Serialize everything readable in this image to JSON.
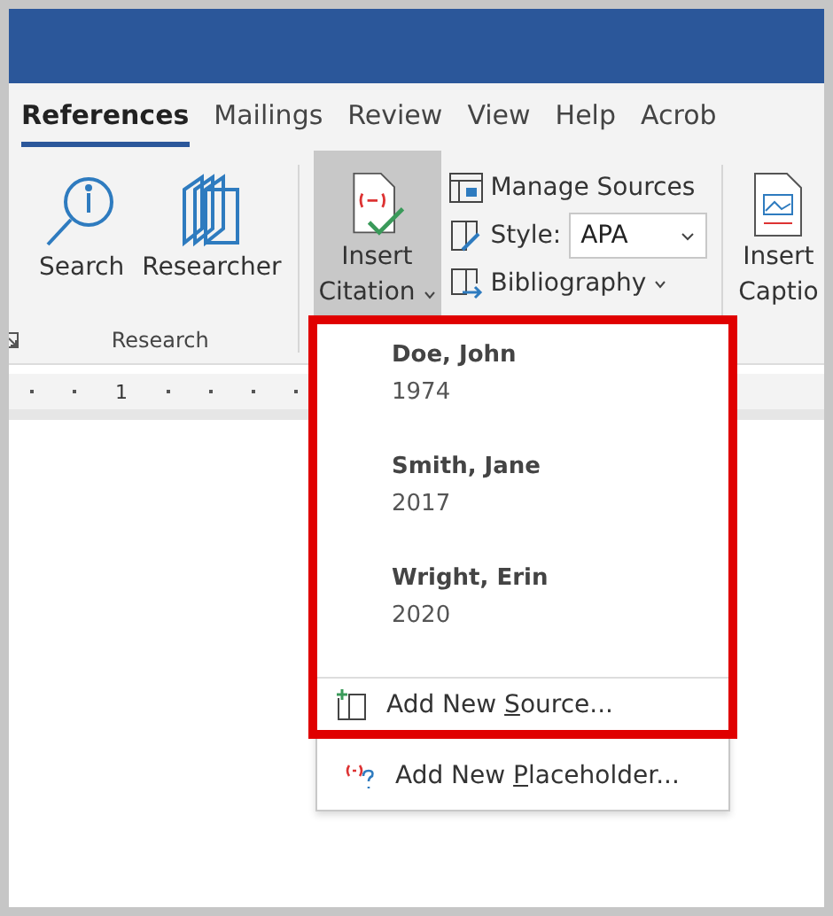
{
  "tabs": [
    {
      "label": "References",
      "selected": true
    },
    {
      "label": "Mailings",
      "selected": false
    },
    {
      "label": "Review",
      "selected": false
    },
    {
      "label": "View",
      "selected": false
    },
    {
      "label": "Help",
      "selected": false
    },
    {
      "label": "Acrob",
      "selected": false
    }
  ],
  "ribbon": {
    "research": {
      "buttons": [
        {
          "label": "Search",
          "kind": "search"
        },
        {
          "label": "Researcher",
          "kind": "researcher"
        }
      ],
      "group_label": "Research"
    },
    "insert_citation": {
      "label_lines": [
        "Insert",
        "Citation"
      ],
      "pressed": true
    },
    "manage_sources": "Manage Sources",
    "style_label": "Style:",
    "style_value": "APA",
    "bibliography": "Bibliography",
    "insert_caption": {
      "label_lines": [
        "Insert",
        "Captio"
      ]
    }
  },
  "ruler": {
    "number": "1"
  },
  "citation_menu": {
    "sources": [
      {
        "author": "Doe, John",
        "year": "1974"
      },
      {
        "author": "Smith, Jane",
        "year": "2017"
      },
      {
        "author": "Wright, Erin",
        "year": "2020"
      }
    ],
    "actions": [
      {
        "kind": "source",
        "label_parts": [
          "Add New ",
          "S",
          "ource..."
        ]
      },
      {
        "kind": "placeholder",
        "label_parts": [
          "Add New ",
          "P",
          "laceholder..."
        ]
      }
    ]
  },
  "highlight_frame": true
}
